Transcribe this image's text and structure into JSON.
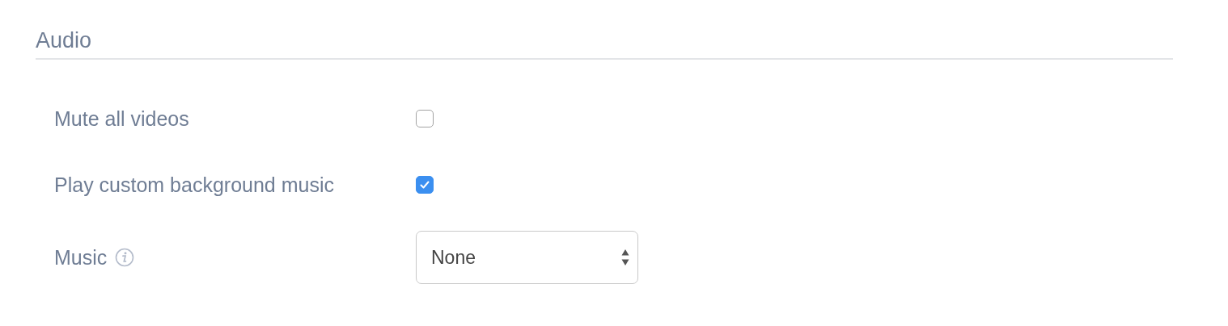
{
  "section": {
    "title": "Audio"
  },
  "rows": [
    {
      "kind": "checkbox",
      "label": "Mute all videos",
      "checked": false
    },
    {
      "kind": "checkbox",
      "label": "Play custom background music",
      "checked": true
    },
    {
      "kind": "select",
      "label": "Music",
      "info": true,
      "value": "None"
    }
  ]
}
